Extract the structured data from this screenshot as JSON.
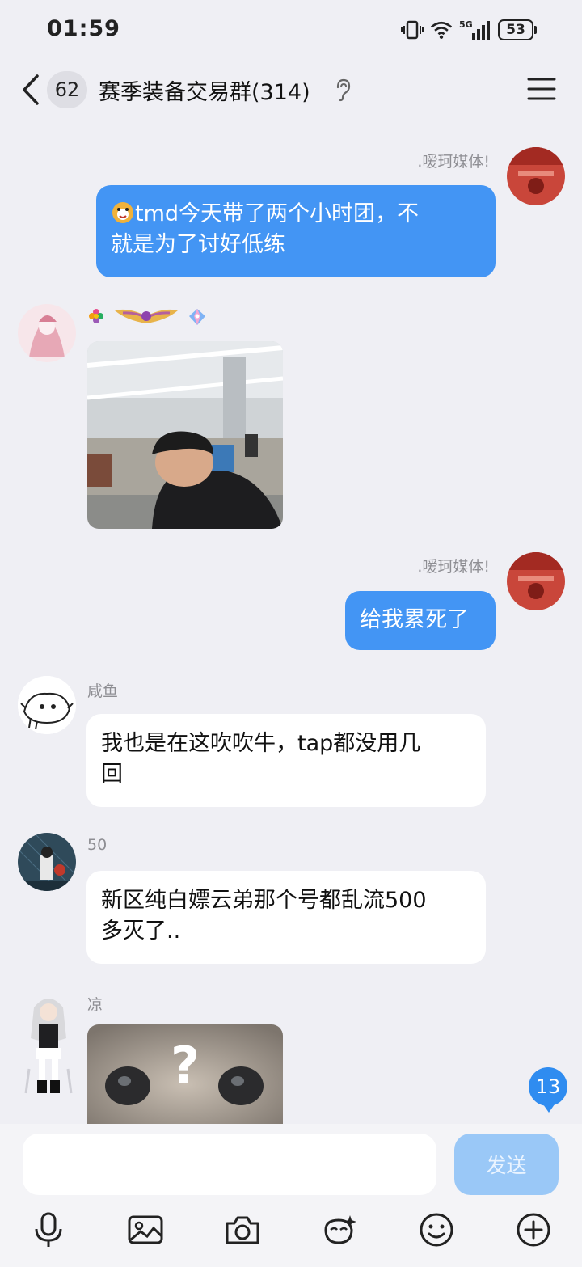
{
  "status_bar": {
    "time": "01:59",
    "battery": "53",
    "network": "5G"
  },
  "header": {
    "unread_count": "62",
    "title": "赛季装备交易群(314)"
  },
  "messages": [
    {
      "sender": ".嗳珂媒体!",
      "text_line1": "tmd今天带了两个小时团，不",
      "text_line2": "就是为了讨好低练",
      "direction": "out"
    },
    {
      "sender": "",
      "type": "image",
      "direction": "in"
    },
    {
      "sender": ".嗳珂媒体!",
      "text": "给我累死了",
      "direction": "out"
    },
    {
      "sender": "咸鱼",
      "text_line1": "我也是在这吹吹牛，tap都没用几",
      "text_line2": "回",
      "direction": "in"
    },
    {
      "sender": "50",
      "text_line1": "新区纯白嫖云弟那个号都乱流500",
      "text_line2": "多灭了..",
      "direction": "in"
    },
    {
      "sender": "凉",
      "type": "image",
      "image_text": "?",
      "direction": "in"
    }
  ],
  "unread_badge": "13",
  "composer": {
    "value": "",
    "placeholder": "",
    "send_label": "发送"
  },
  "toolbar": [
    "mic-icon",
    "image-icon",
    "camera-icon",
    "sticker-icon",
    "emoji-icon",
    "plus-icon"
  ],
  "colors": {
    "bubble_out": "#4395f4",
    "bubble_in": "#ffffff",
    "background": "#efeff4",
    "send_disabled": "#9ac8f7"
  }
}
